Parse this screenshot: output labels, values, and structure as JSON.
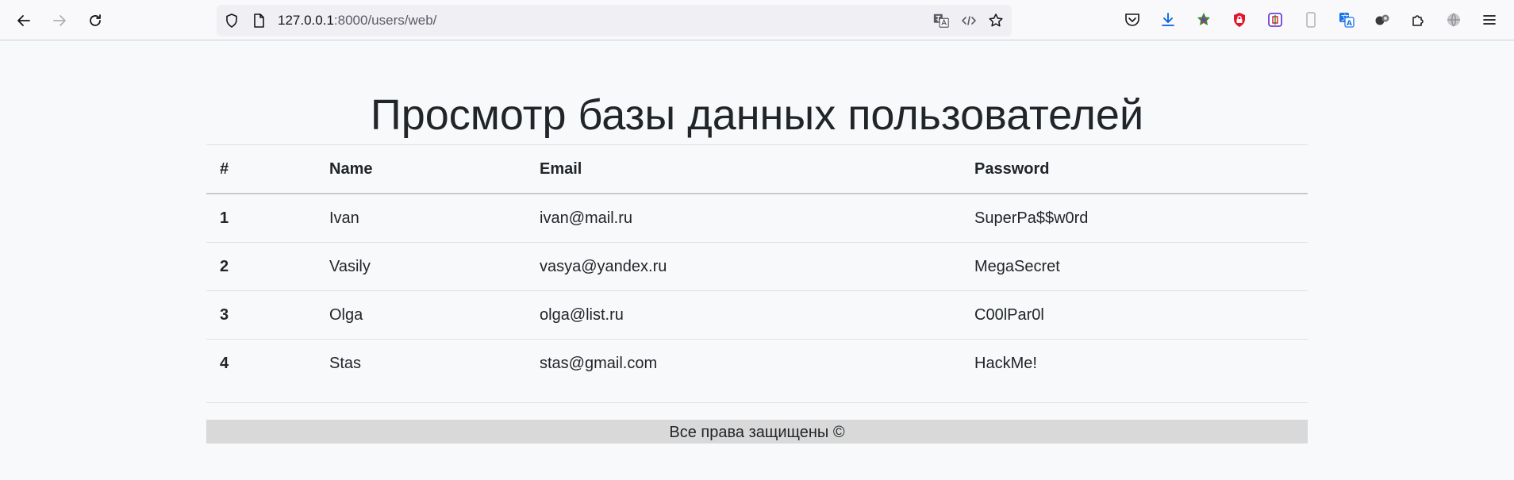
{
  "browser": {
    "url_host": "127.0.0.1",
    "url_rest": ":8000/users/web/"
  },
  "page": {
    "title": "Просмотр базы данных пользователей",
    "footer": "Все права защищены ©"
  },
  "table": {
    "headers": [
      "#",
      "Name",
      "Email",
      "Password"
    ],
    "rows": [
      {
        "num": "1",
        "name": "Ivan",
        "email": "ivan@mail.ru",
        "password": "SuperPa$$w0rd"
      },
      {
        "num": "2",
        "name": "Vasily",
        "email": "vasya@yandex.ru",
        "password": "MegaSecret"
      },
      {
        "num": "3",
        "name": "Olga",
        "email": "olga@list.ru",
        "password": "C00lPar0l"
      },
      {
        "num": "4",
        "name": "Stas",
        "email": "stas@gmail.com",
        "password": "HackMe!"
      }
    ]
  },
  "icons": {
    "back": "arrow-left-icon",
    "forward": "arrow-right-icon",
    "reload": "reload-icon",
    "shield": "shield-icon",
    "page": "page-icon",
    "translate": "translate-icon",
    "code": "code-icon",
    "bookmark": "star-icon",
    "pocket": "pocket-icon",
    "downloads": "download-icon",
    "menu": "hamburger-menu-icon"
  },
  "colors": {
    "background": "#f8f9fa",
    "footer_bg": "#d9d9d9",
    "download_accent": "#0060df"
  }
}
